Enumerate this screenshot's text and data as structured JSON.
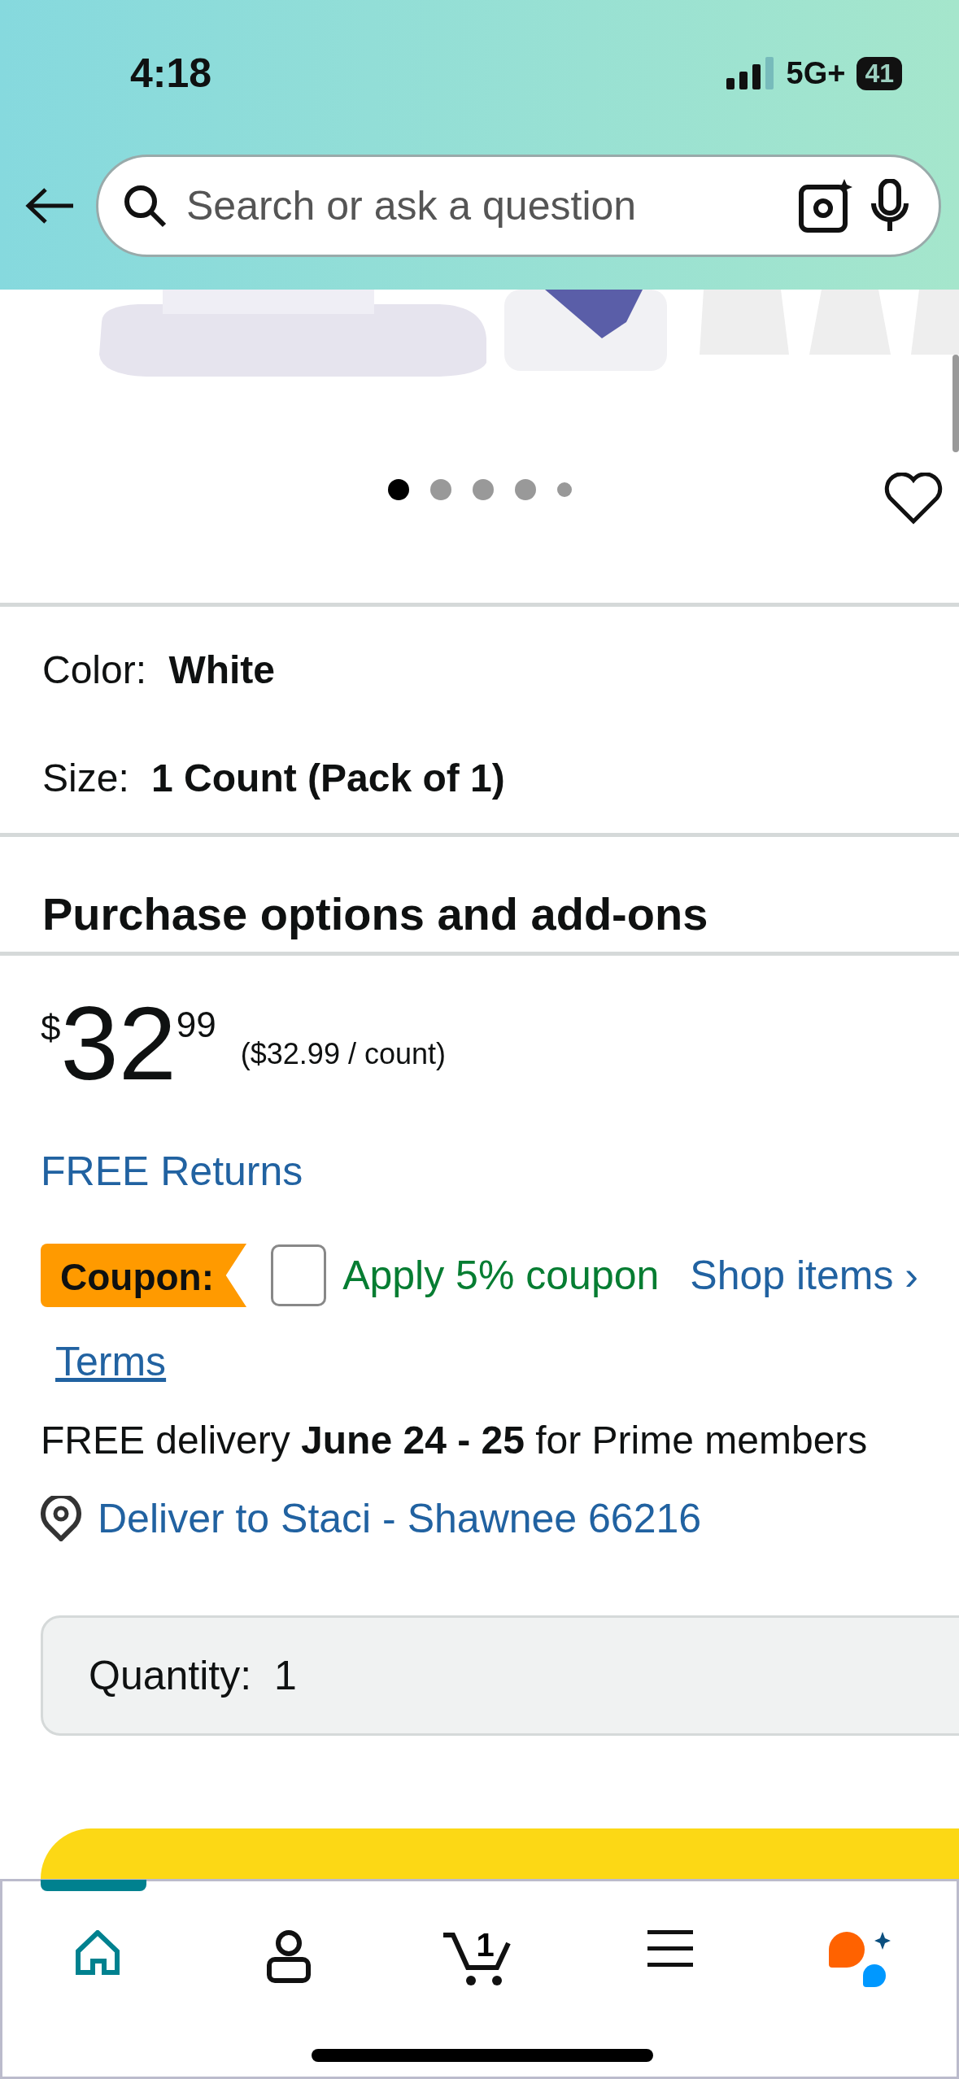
{
  "status_bar": {
    "time": "4:18",
    "network": "5G+",
    "battery": "41"
  },
  "search": {
    "placeholder": "Search or ask a question"
  },
  "gallery": {
    "kind": "picture",
    "dots": [
      {
        "selected": true
      },
      {
        "selected": false
      },
      {
        "selected": false
      },
      {
        "selected": false
      },
      {
        "selected": false
      }
    ],
    "favorite": false
  },
  "variations": [
    {
      "label": "Color:",
      "value": "White"
    },
    {
      "label": "Size:",
      "value": "1 Count (Pack of 1)"
    }
  ],
  "section_title": "Purchase options and add-ons",
  "price": {
    "symbol": "$",
    "whole": "32",
    "fraction": "99",
    "unit_price": "($32.99 / count)"
  },
  "returns_link": "FREE Returns",
  "coupon": {
    "badge": "Coupon:",
    "checked": false,
    "label": "Apply 5% coupon",
    "shop_link": "Shop items ›",
    "terms": "Terms"
  },
  "delivery": "FREE delivery **June 24 - 25** for Prime members",
  "deliver_to": "Deliver to Staci - Shawnee 66216",
  "quantity": {
    "label": "Quantity:",
    "value": "1"
  },
  "nav": [
    {
      "kind": "home",
      "selected": true
    },
    {
      "kind": "account",
      "selected": false
    },
    {
      "kind": "cart",
      "selected": false,
      "badge": "1"
    },
    {
      "kind": "menu",
      "selected": false
    },
    {
      "kind": "assistant",
      "selected": false
    }
  ]
}
